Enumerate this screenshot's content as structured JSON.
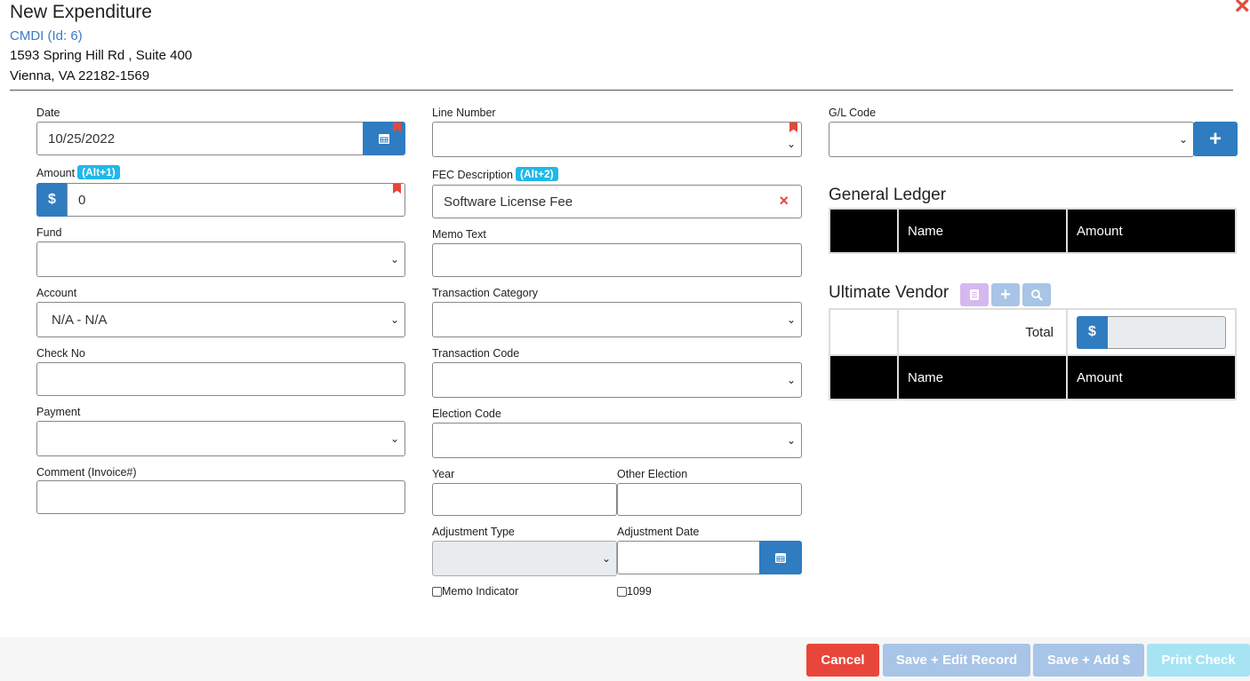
{
  "header": {
    "title": "New Expenditure",
    "org_link": "CMDI (Id: 6)",
    "address_line1": "1593 Spring Hill Rd , Suite 400",
    "address_line2": "Vienna, VA 22182-1569",
    "close_icon": "×"
  },
  "form": {
    "date": {
      "label": "Date",
      "value": "10/25/2022"
    },
    "amount": {
      "label": "Amount",
      "shortcut": "(Alt+1)",
      "currency": "$",
      "value": "0"
    },
    "fund": {
      "label": "Fund",
      "value": ""
    },
    "account": {
      "label": "Account",
      "value": "N/A - N/A"
    },
    "check_no": {
      "label": "Check No",
      "value": ""
    },
    "payment": {
      "label": "Payment",
      "value": ""
    },
    "comment": {
      "label": "Comment (Invoice#)",
      "value": ""
    },
    "line_number": {
      "label": "Line Number",
      "value": ""
    },
    "fec_description": {
      "label": "FEC Description",
      "shortcut": "(Alt+2)",
      "value": "Software License Fee"
    },
    "memo_text": {
      "label": "Memo Text",
      "value": ""
    },
    "transaction_category": {
      "label": "Transaction Category",
      "value": ""
    },
    "transaction_code": {
      "label": "Transaction Code",
      "value": ""
    },
    "election_code": {
      "label": "Election Code",
      "value": ""
    },
    "year": {
      "label": "Year",
      "value": ""
    },
    "other_election": {
      "label": "Other Election",
      "value": ""
    },
    "adjustment_type": {
      "label": "Adjustment Type",
      "value": ""
    },
    "adjustment_date": {
      "label": "Adjustment Date",
      "value": ""
    },
    "memo_indicator": {
      "label": "Memo Indicator",
      "checked": false
    },
    "form_1099": {
      "label": "1099",
      "checked": false
    },
    "gl_code": {
      "label": "G/L Code",
      "value": ""
    }
  },
  "general_ledger": {
    "title": "General Ledger",
    "columns": [
      "",
      "Name",
      "Amount"
    ]
  },
  "ultimate_vendor": {
    "title": "Ultimate Vendor",
    "total_label": "Total",
    "currency": "$",
    "total_value": "",
    "columns": [
      "",
      "Name",
      "Amount"
    ]
  },
  "footer": {
    "cancel": "Cancel",
    "save_edit": "Save + Edit Record",
    "save_add": "Save + Add $",
    "print_check": "Print Check"
  },
  "colors": {
    "primary": "#2f7cc1",
    "danger": "#e8463a",
    "badge": "#1fb8e8",
    "disabled_button": "#a8c4e6",
    "print_disabled": "#a6e4f4"
  }
}
